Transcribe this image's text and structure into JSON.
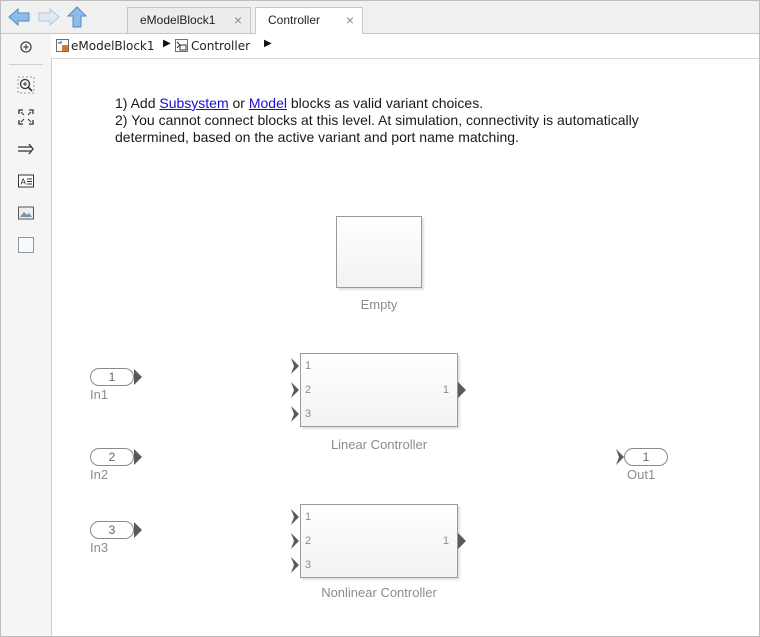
{
  "tabs": [
    {
      "label": "eModelBlock1",
      "close": "×",
      "active": false
    },
    {
      "label": "Controller",
      "close": "×",
      "active": true
    }
  ],
  "breadcrumb": {
    "items": [
      {
        "label": "eModelBlock1"
      },
      {
        "label": "Controller"
      }
    ],
    "separator": "▶"
  },
  "info": {
    "line1_prefix": "1) Add ",
    "link_subsystem": "Subsystem",
    "line1_mid": " or ",
    "link_model": "Model",
    "line1_suffix": " blocks as valid variant choices.",
    "line2": "2) You cannot connect blocks at this level. At simulation, connectivity is automatically",
    "line3": "determined, based on the active variant and port name matching."
  },
  "blocks": {
    "empty": {
      "label": "Empty"
    },
    "linear": {
      "label": "Linear Controller",
      "inputs": [
        "1",
        "2",
        "3"
      ],
      "outputs": [
        "1"
      ]
    },
    "nonlinear": {
      "label": "Nonlinear Controller",
      "inputs": [
        "1",
        "2",
        "3"
      ],
      "outputs": [
        "1"
      ]
    }
  },
  "inports": [
    {
      "number": "1",
      "name": "In1"
    },
    {
      "number": "2",
      "name": "In2"
    },
    {
      "number": "3",
      "name": "In3"
    }
  ],
  "outports": [
    {
      "number": "1",
      "name": "Out1"
    }
  ],
  "palette": [
    "hide-panel-icon",
    "zoom-icon",
    "fit-view-icon",
    "route-lines-icon",
    "annotation-icon",
    "image-icon",
    "area-icon"
  ],
  "colors": {
    "link": "#1a0dcc",
    "nav_arrow": "#6fa8dc",
    "block_label": "#8c8c8c"
  }
}
